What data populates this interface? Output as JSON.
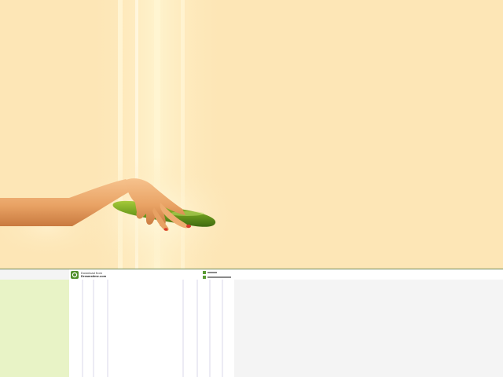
{
  "scene": {
    "background_color": "#fde6b6",
    "skin_color": "#f2b37a",
    "cucumber_color": "#6f9e1e",
    "nail_color": "#d83a2c",
    "divider_color": "#6f8a57",
    "lower_left_color": "#e8f3c6",
    "lower_right_color": "#f4f4f4"
  },
  "watermark": {
    "logo_icon": "dreamstime-logo-icon",
    "line1": "Download from",
    "line2": "Dreamstime.com"
  }
}
